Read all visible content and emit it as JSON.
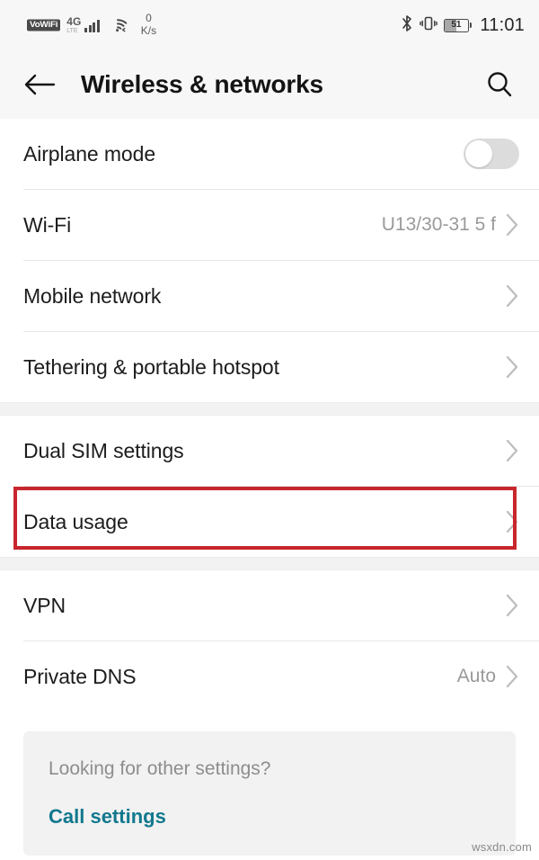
{
  "status_bar": {
    "vowifi_label": "VoWiFi",
    "network_gen": "4G",
    "network_sub": "LTE",
    "data_rate_value": "0",
    "data_rate_unit": "K/s",
    "battery_percent": "51",
    "battery_level": 51,
    "time": "11:01",
    "icons": [
      "vowifi-badge",
      "signal-bars-icon",
      "wifi-icon",
      "bluetooth-icon",
      "vibrate-icon",
      "battery-icon"
    ]
  },
  "app_bar": {
    "title": "Wireless & networks",
    "back_icon": "arrow-left-icon",
    "search_icon": "search-icon"
  },
  "sections": [
    {
      "rows": [
        {
          "label": "Airplane mode",
          "value": "",
          "control": "toggle",
          "toggle_on": false
        },
        {
          "label": "Wi-Fi",
          "value": "U13/30-31 5 f",
          "control": "chevron"
        },
        {
          "label": "Mobile network",
          "value": "",
          "control": "chevron"
        },
        {
          "label": "Tethering & portable hotspot",
          "value": "",
          "control": "chevron"
        }
      ]
    },
    {
      "rows": [
        {
          "label": "Dual SIM settings",
          "value": "",
          "control": "chevron"
        },
        {
          "label": "Data usage",
          "value": "",
          "control": "chevron",
          "highlighted": true
        }
      ]
    },
    {
      "rows": [
        {
          "label": "VPN",
          "value": "",
          "control": "chevron"
        },
        {
          "label": "Private DNS",
          "value": "Auto",
          "control": "chevron"
        }
      ]
    }
  ],
  "footer": {
    "question": "Looking for other settings?",
    "link_label": "Call settings"
  },
  "watermark": "wsxdn.com",
  "colors": {
    "highlight": "#c7262c",
    "link": "#11788e",
    "band": "#f2f2f2",
    "appbar_bg": "#f7f7f7"
  }
}
